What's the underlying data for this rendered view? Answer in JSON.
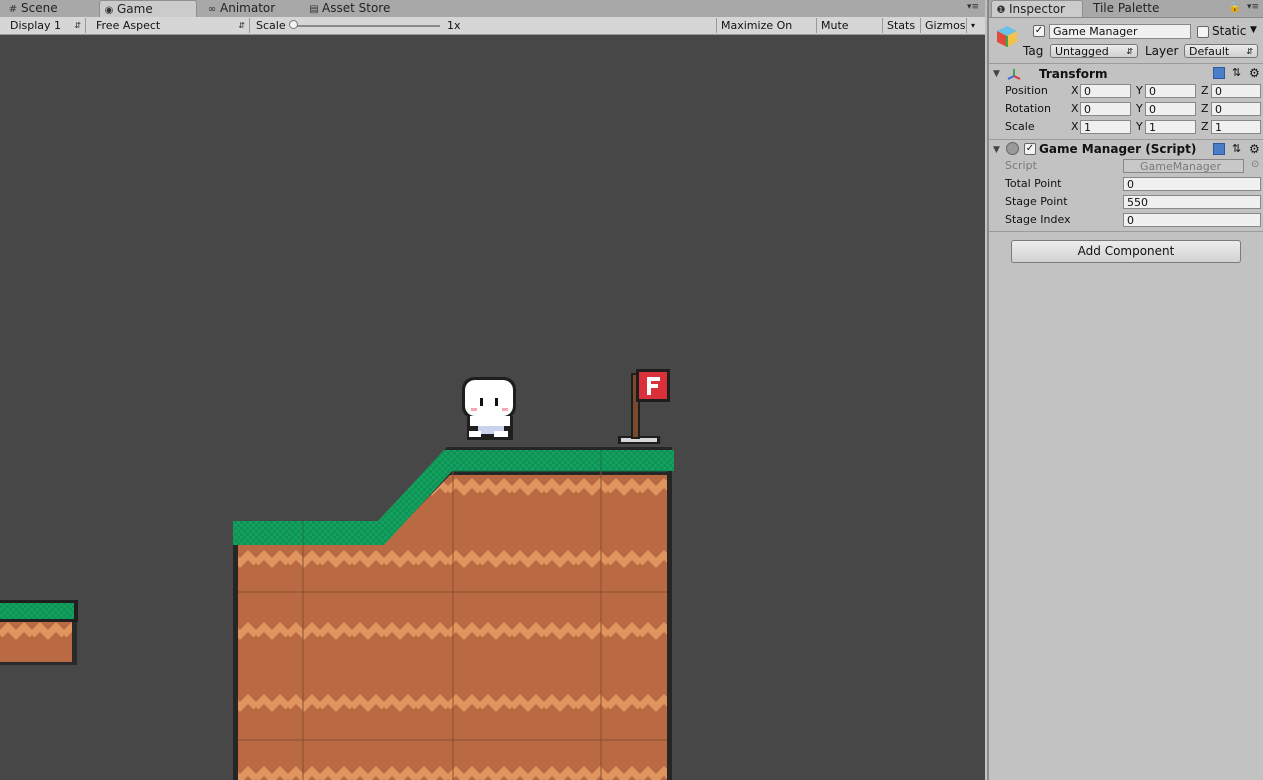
{
  "left_tabs": [
    {
      "label": "Scene",
      "icon": "scene-icon"
    },
    {
      "label": "Game",
      "icon": "game-icon"
    },
    {
      "label": "Animator",
      "icon": "animator-icon"
    },
    {
      "label": "Asset Store",
      "icon": "asset-store-icon"
    }
  ],
  "game_toolbar": {
    "display": "Display 1",
    "aspect": "Free Aspect",
    "scale_label": "Scale",
    "scale_value": "1x",
    "maximize_on_play": "Maximize On Play",
    "mute_audio": "Mute Audio",
    "stats": "Stats",
    "gizmos": "Gizmos"
  },
  "colors": {
    "viewport_bg": "#474747",
    "grass": "#14a05e",
    "dirt": "#b96a42",
    "dirt_wave": "#e0955f",
    "flag_red": "#d9303a"
  },
  "inspector": {
    "tabs": [
      "Inspector",
      "Tile Palette"
    ],
    "object_name": "Game Manager",
    "static_label": "Static",
    "tag_label": "Tag",
    "tag_value": "Untagged",
    "layer_label": "Layer",
    "layer_value": "Default",
    "transform": {
      "title": "Transform",
      "rows": [
        {
          "label": "Position",
          "x": "0",
          "y": "0",
          "z": "0"
        },
        {
          "label": "Rotation",
          "x": "0",
          "y": "0",
          "z": "0"
        },
        {
          "label": "Scale",
          "x": "1",
          "y": "1",
          "z": "1"
        }
      ],
      "axis": [
        "X",
        "Y",
        "Z"
      ]
    },
    "script_component": {
      "title": "Game Manager (Script)",
      "script_label": "Script",
      "script_value": "GameManager",
      "fields": [
        {
          "label": "Total Point",
          "value": "0"
        },
        {
          "label": "Stage Point",
          "value": "550"
        },
        {
          "label": "Stage Index",
          "value": "0"
        }
      ]
    },
    "add_component": "Add Component"
  }
}
